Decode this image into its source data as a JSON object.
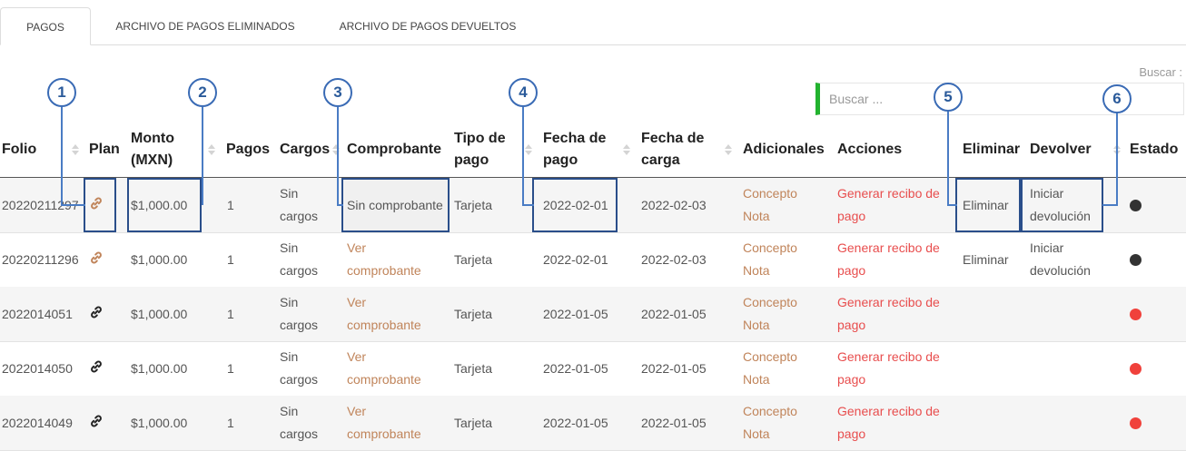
{
  "tabs": [
    {
      "label": "PAGOS",
      "active": true
    },
    {
      "label": "ARCHIVO DE PAGOS ELIMINADOS",
      "active": false
    },
    {
      "label": "ARCHIVO DE PAGOS DEVUELTOS",
      "active": false
    }
  ],
  "search": {
    "label": "Buscar :",
    "placeholder": "Buscar ..."
  },
  "callouts": [
    "1",
    "2",
    "3",
    "4",
    "5",
    "6"
  ],
  "table": {
    "headers": {
      "folio": "Folio",
      "plan": "Plan",
      "monto_1": "Monto",
      "monto_2": "(MXN)",
      "pagos": "Pagos",
      "cargos": "Cargos",
      "comprobante": "Comprobante",
      "tipo_1": "Tipo de",
      "tipo_2": "pago",
      "fecha_pago_1": "Fecha de",
      "fecha_pago_2": "pago",
      "fecha_carga_1": "Fecha de",
      "fecha_carga_2": "carga",
      "adicionales": "Adicionales",
      "acciones": "Acciones",
      "eliminar": "Eliminar",
      "devolver": "Devolver",
      "estado": "Estado"
    },
    "rows": [
      {
        "folio": "20220211297",
        "plan_icon": "link-icon",
        "monto": "$1,000.00",
        "pagos": "1",
        "cargos_1": "Sin",
        "cargos_2": "cargos",
        "comprobante_1": "Sin comprobante",
        "comprobante_2": "",
        "tipo": "Tarjeta",
        "fecha_pago": "2022-02-01",
        "fecha_carga": "2022-02-03",
        "adicional_1": "Concepto",
        "adicional_2": "Nota",
        "accion_1": "Generar recibo de",
        "accion_2": "pago",
        "eliminar": "Eliminar",
        "devolver_1": "Iniciar",
        "devolver_2": "devolución",
        "estado_color": "#333333"
      },
      {
        "folio": "20220211296",
        "plan_icon": "link-icon",
        "monto": "$1,000.00",
        "pagos": "1",
        "cargos_1": "Sin",
        "cargos_2": "cargos",
        "comprobante_1": "Ver",
        "comprobante_2": "comprobante",
        "tipo": "Tarjeta",
        "fecha_pago": "2022-02-01",
        "fecha_carga": "2022-02-03",
        "adicional_1": "Concepto",
        "adicional_2": "Nota",
        "accion_1": "Generar recibo de",
        "accion_2": "pago",
        "eliminar": "Eliminar",
        "devolver_1": "Iniciar",
        "devolver_2": "devolución",
        "estado_color": "#333333"
      },
      {
        "folio": "2022014051",
        "plan_icon": "link-icon",
        "monto": "$1,000.00",
        "pagos": "1",
        "cargos_1": "Sin",
        "cargos_2": "cargos",
        "comprobante_1": "Ver",
        "comprobante_2": "comprobante",
        "tipo": "Tarjeta",
        "fecha_pago": "2022-01-05",
        "fecha_carga": "2022-01-05",
        "adicional_1": "Concepto",
        "adicional_2": "Nota",
        "accion_1": "Generar recibo de",
        "accion_2": "pago",
        "eliminar": "",
        "devolver_1": "",
        "devolver_2": "",
        "estado_color": "#f0413b"
      },
      {
        "folio": "2022014050",
        "plan_icon": "link-icon",
        "monto": "$1,000.00",
        "pagos": "1",
        "cargos_1": "Sin",
        "cargos_2": "cargos",
        "comprobante_1": "Ver",
        "comprobante_2": "comprobante",
        "tipo": "Tarjeta",
        "fecha_pago": "2022-01-05",
        "fecha_carga": "2022-01-05",
        "adicional_1": "Concepto",
        "adicional_2": "Nota",
        "accion_1": "Generar recibo de",
        "accion_2": "pago",
        "eliminar": "",
        "devolver_1": "",
        "devolver_2": "",
        "estado_color": "#f0413b"
      },
      {
        "folio": "2022014049",
        "plan_icon": "link-icon",
        "monto": "$1,000.00",
        "pagos": "1",
        "cargos_1": "Sin",
        "cargos_2": "cargos",
        "comprobante_1": "Ver",
        "comprobante_2": "comprobante",
        "tipo": "Tarjeta",
        "fecha_pago": "2022-01-05",
        "fecha_carga": "2022-01-05",
        "adicional_1": "Concepto",
        "adicional_2": "Nota",
        "accion_1": "Generar recibo de",
        "accion_2": "pago",
        "eliminar": "",
        "devolver_1": "",
        "devolver_2": "",
        "estado_color": "#f0413b"
      }
    ]
  }
}
